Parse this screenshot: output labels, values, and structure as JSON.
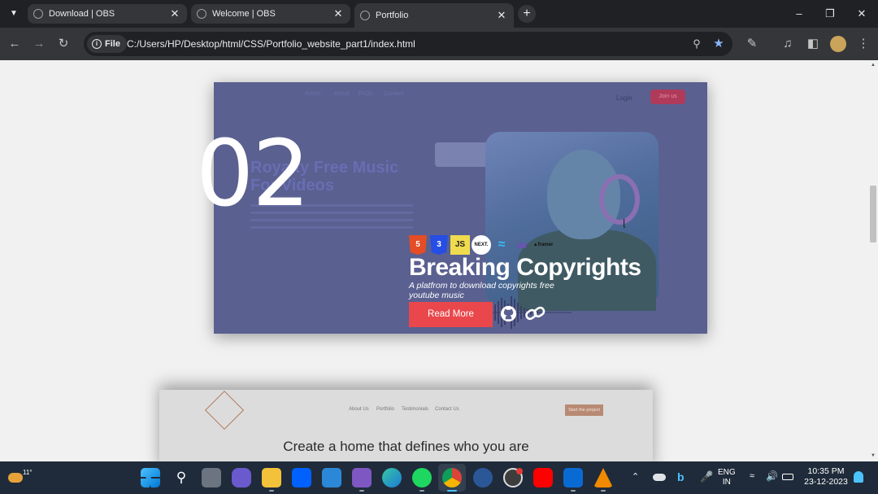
{
  "browser": {
    "tabs": [
      {
        "title": "Download | OBS"
      },
      {
        "title": "Welcome | OBS"
      },
      {
        "title": "Portfolio"
      }
    ],
    "address_chip": "File",
    "url": "C:/Users/HP/Desktop/html/CSS/Portfolio_website_part1/index.html"
  },
  "card1": {
    "number": "02",
    "bg_title_line1": "Royalty Free Music",
    "bg_title_line2": "For Videos",
    "bg_nav": [
      "Artists",
      "About",
      "FAQs",
      "Contact"
    ],
    "bg_login": "Login",
    "bg_join": "Join us",
    "tech": [
      "HTML5",
      "CSS3",
      "JS",
      "NEXT.",
      "tailwind",
      "redux",
      "framer"
    ],
    "headline": "Breaking Copyrights",
    "tagline": "A platfrom to download copyrights free youtube music",
    "read_more": "Read More"
  },
  "card2": {
    "nav": [
      "About Us",
      "Portfolio",
      "Testimonials",
      "Contact Us"
    ],
    "cta": "Start the project",
    "headline": "Create a home that defines who you are"
  },
  "taskbar": {
    "temperature": "11°",
    "lang_line1": "ENG",
    "lang_line2": "IN",
    "time": "10:35 PM",
    "date": "23-12-2023"
  },
  "colors": {
    "chrome_dark": "#202124",
    "chrome_toolbar": "#35363a",
    "accent_red": "#e9474c",
    "card_overlay": "#5a6090",
    "taskbar": "#1f2b3a"
  }
}
